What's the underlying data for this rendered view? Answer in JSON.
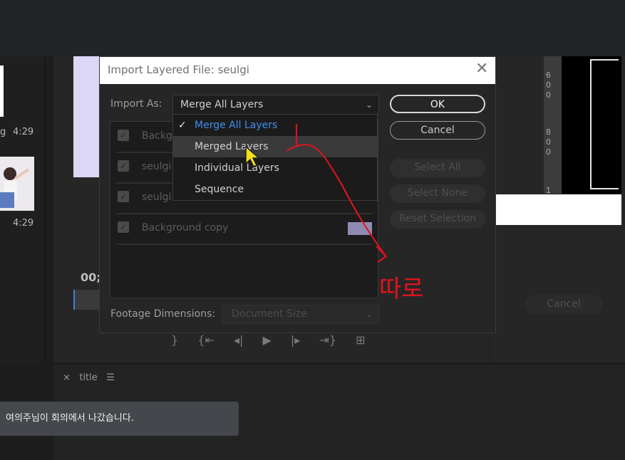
{
  "background_panels": {
    "clip_duration_1": "4:29",
    "clip_duration_2": "4:29",
    "clip_prefix": "g",
    "timecode_fragment": "00;",
    "timeline_tab": "title",
    "ghost_cancel": "Cancel",
    "ruler_marks": [
      "6",
      "0",
      "0",
      "8",
      "0",
      "0",
      "1"
    ]
  },
  "dialog": {
    "title": "Import Layered File: seulgi",
    "import_as_label": "Import As:",
    "import_as_value": "Merge All Layers",
    "layers": [
      {
        "name": "Background",
        "checked": true
      },
      {
        "name": "seulgi",
        "checked": true
      },
      {
        "name": "seulgi",
        "checked": true
      },
      {
        "name": "Background copy",
        "checked": true,
        "swatch": "#8f8ab0"
      }
    ],
    "buttons": {
      "ok": "OK",
      "cancel": "Cancel",
      "select_all": "Select All",
      "select_none": "Select None",
      "reset_selection": "Reset Selection"
    },
    "footage_label": "Footage Dimensions:",
    "footage_value": "Document Size"
  },
  "dropdown": {
    "options": [
      {
        "label": "Merge All Layers",
        "selected": true
      },
      {
        "label": "Merged Layers",
        "hovered": true
      },
      {
        "label": "Individual Layers"
      },
      {
        "label": "Sequence"
      }
    ]
  },
  "annotation": {
    "text": "따로",
    "color": "#e2131e"
  },
  "notification": {
    "text": "여의주님이 회의에서 나갔습니다."
  },
  "colors": {
    "accent": "#3f8ff0",
    "lavender": "#dcd6f7"
  }
}
